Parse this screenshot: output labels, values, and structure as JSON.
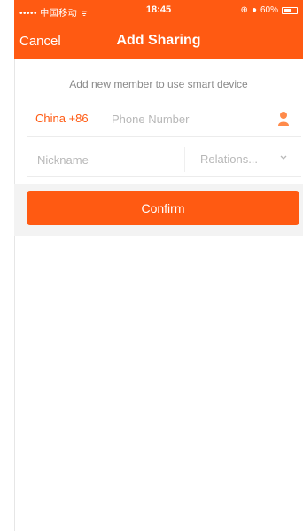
{
  "status_bar": {
    "carrier": "••••• 中国移动 ᯤ",
    "time": "18:45",
    "battery_text": "60%",
    "battery_level": 0.6
  },
  "navbar": {
    "cancel_label": "Cancel",
    "title": "Add Sharing"
  },
  "form": {
    "hint": "Add new member to use smart device",
    "country_code": "China +86",
    "phone_placeholder": "Phone Number",
    "nickname_placeholder": "Nickname",
    "relation_placeholder": "Relations..."
  },
  "confirm_label": "Confirm",
  "colors": {
    "accent": "#ff5a12",
    "text_placeholder": "#b8b8b8"
  },
  "icons": [
    "contact-person-icon",
    "chevron-down-icon",
    "alarm-icon",
    "lock-icon",
    "battery-icon"
  ]
}
